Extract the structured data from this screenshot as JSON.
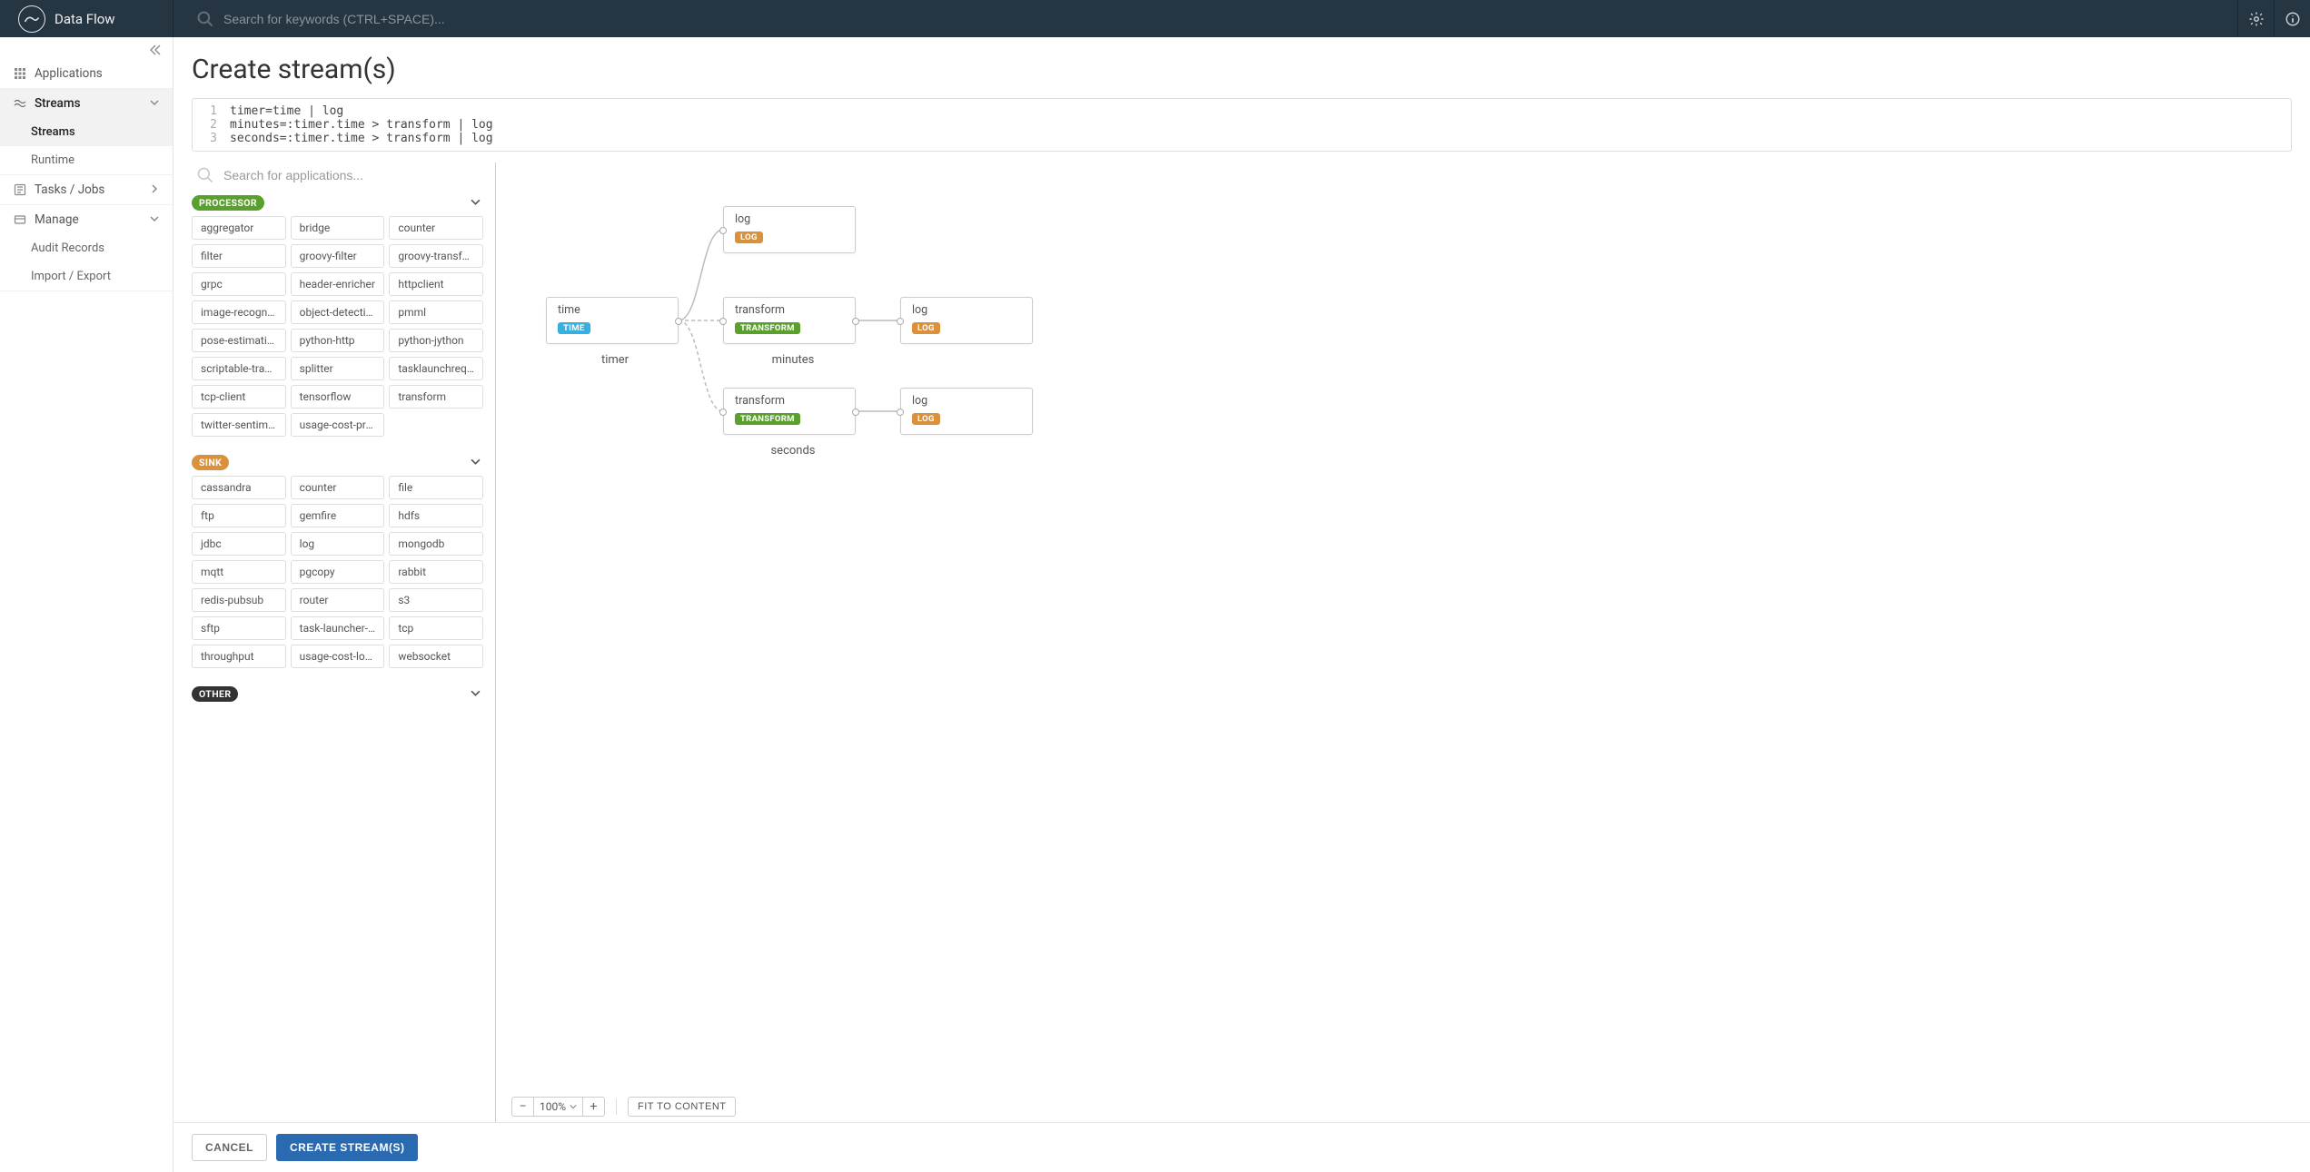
{
  "header": {
    "app_name": "Data Flow",
    "search_placeholder": "Search for keywords (CTRL+SPACE)..."
  },
  "sidebar": {
    "items": [
      {
        "label": "Applications",
        "icon": "apps-icon"
      },
      {
        "label": "Streams",
        "icon": "streams-icon",
        "active": true,
        "expandable": true,
        "children": [
          {
            "label": "Streams",
            "active": true
          },
          {
            "label": "Runtime"
          }
        ]
      },
      {
        "label": "Tasks / Jobs",
        "icon": "tasks-icon",
        "expandable": true
      },
      {
        "label": "Manage",
        "icon": "manage-icon",
        "expandable": true,
        "children": [
          {
            "label": "Audit Records"
          },
          {
            "label": "Import / Export"
          }
        ]
      }
    ]
  },
  "page": {
    "title": "Create stream(s)"
  },
  "editor": {
    "lines": [
      "timer=time | log",
      "minutes=:timer.time > transform | log",
      "seconds=:timer.time > transform | log"
    ]
  },
  "palette": {
    "search_placeholder": "Search for applications...",
    "groups": [
      {
        "name": "PROCESSOR",
        "tag_class": "pill-processor",
        "items": [
          "aggregator",
          "bridge",
          "counter",
          "filter",
          "groovy-filter",
          "groovy-transform",
          "grpc",
          "header-enricher",
          "httpclient",
          "image-recognition",
          "object-detection",
          "pmml",
          "pose-estimation",
          "python-http",
          "python-jython",
          "scriptable-transform",
          "splitter",
          "tasklaunchrequest",
          "tcp-client",
          "tensorflow",
          "transform",
          "twitter-sentiment",
          "usage-cost-processor"
        ]
      },
      {
        "name": "SINK",
        "tag_class": "pill-sink",
        "items": [
          "cassandra",
          "counter",
          "file",
          "ftp",
          "gemfire",
          "hdfs",
          "jdbc",
          "log",
          "mongodb",
          "mqtt",
          "pgcopy",
          "rabbit",
          "redis-pubsub",
          "router",
          "s3",
          "sftp",
          "task-launcher-dataflow",
          "tcp",
          "throughput",
          "usage-cost-logger",
          "websocket"
        ]
      },
      {
        "name": "OTHER",
        "tag_class": "pill-other",
        "items": []
      }
    ]
  },
  "canvas": {
    "zoom": "100%",
    "fit_label": "FIT TO CONTENT",
    "nodes": {
      "timer": {
        "title": "time",
        "tag": "TIME",
        "tag_class": "tag-time"
      },
      "log_top": {
        "title": "log",
        "tag": "LOG",
        "tag_class": "tag-log"
      },
      "trans_mid": {
        "title": "transform",
        "tag": "TRANSFORM",
        "tag_class": "tag-transform"
      },
      "log_mid": {
        "title": "log",
        "tag": "LOG",
        "tag_class": "tag-log"
      },
      "trans_bot": {
        "title": "transform",
        "tag": "TRANSFORM",
        "tag_class": "tag-transform"
      },
      "log_bot": {
        "title": "log",
        "tag": "LOG",
        "tag_class": "tag-log"
      }
    },
    "stream_labels": {
      "timer": "timer",
      "minutes": "minutes",
      "seconds": "seconds"
    }
  },
  "footer": {
    "cancel": "CANCEL",
    "create": "CREATE STREAM(S)"
  }
}
